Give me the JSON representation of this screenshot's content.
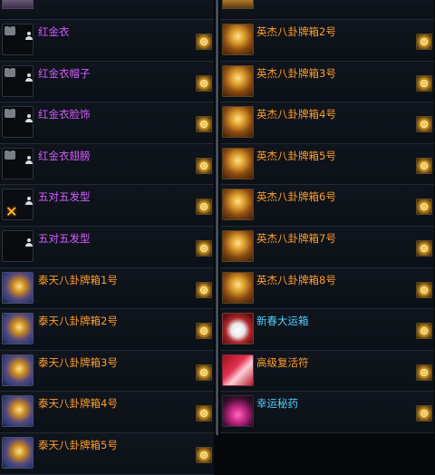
{
  "colors": {
    "purple_name": "#d25cff",
    "orange_name": "#ff9d2b",
    "cyan_name": "#4fd1ff"
  },
  "left_items": [
    {
      "label": "",
      "icon": "partial"
    },
    {
      "label": "红金衣",
      "color": "#d25cff",
      "icon": "shirt-person-icon"
    },
    {
      "label": "红金衣帽子",
      "color": "#d25cff",
      "icon": "shirt-person-icon"
    },
    {
      "label": "红金衣脸饰",
      "color": "#d25cff",
      "icon": "shirt-person-icon"
    },
    {
      "label": "红金衣翅膀",
      "color": "#d25cff",
      "icon": "shirt-person-icon"
    },
    {
      "label": "五对五发型",
      "color": "#d25cff",
      "icon": "crossed-hair-icon"
    },
    {
      "label": "五对五发型",
      "color": "#d25cff",
      "icon": "person-icon"
    },
    {
      "label": "泰天八卦牌箱1号",
      "color": "#ff9d2b",
      "icon": "treasure-chest-icon"
    },
    {
      "label": "泰天八卦牌箱2号",
      "color": "#ff9d2b",
      "icon": "treasure-chest-icon"
    },
    {
      "label": "泰天八卦牌箱3号",
      "color": "#ff9d2b",
      "icon": "treasure-chest-icon"
    },
    {
      "label": "泰天八卦牌箱4号",
      "color": "#ff9d2b",
      "icon": "treasure-chest-icon"
    },
    {
      "label": "泰天八卦牌箱5号",
      "color": "#ff9d2b",
      "icon": "treasure-chest-icon"
    }
  ],
  "right_items": [
    {
      "label": "",
      "icon": "partial"
    },
    {
      "label": "英杰八卦牌箱2号",
      "color": "#ff9d2b",
      "icon": "treasure-chest-icon"
    },
    {
      "label": "英杰八卦牌箱3号",
      "color": "#ff9d2b",
      "icon": "treasure-chest-icon"
    },
    {
      "label": "英杰八卦牌箱4号",
      "color": "#ff9d2b",
      "icon": "treasure-chest-icon"
    },
    {
      "label": "英杰八卦牌箱5号",
      "color": "#ff9d2b",
      "icon": "treasure-chest-icon"
    },
    {
      "label": "英杰八卦牌箱6号",
      "color": "#ff9d2b",
      "icon": "treasure-chest-icon"
    },
    {
      "label": "英杰八卦牌箱7号",
      "color": "#ff9d2b",
      "icon": "treasure-chest-icon"
    },
    {
      "label": "英杰八卦牌箱8号",
      "color": "#ff9d2b",
      "icon": "treasure-chest-icon"
    },
    {
      "label": "新春大运箱",
      "color": "#4fd1ff",
      "icon": "new-year-box-icon"
    },
    {
      "label": "高级复活符",
      "color": "#ff9d2b",
      "icon": "revive-charm-icon"
    },
    {
      "label": "幸运秘药",
      "color": "#4fd1ff",
      "icon": "potion-icon"
    }
  ]
}
